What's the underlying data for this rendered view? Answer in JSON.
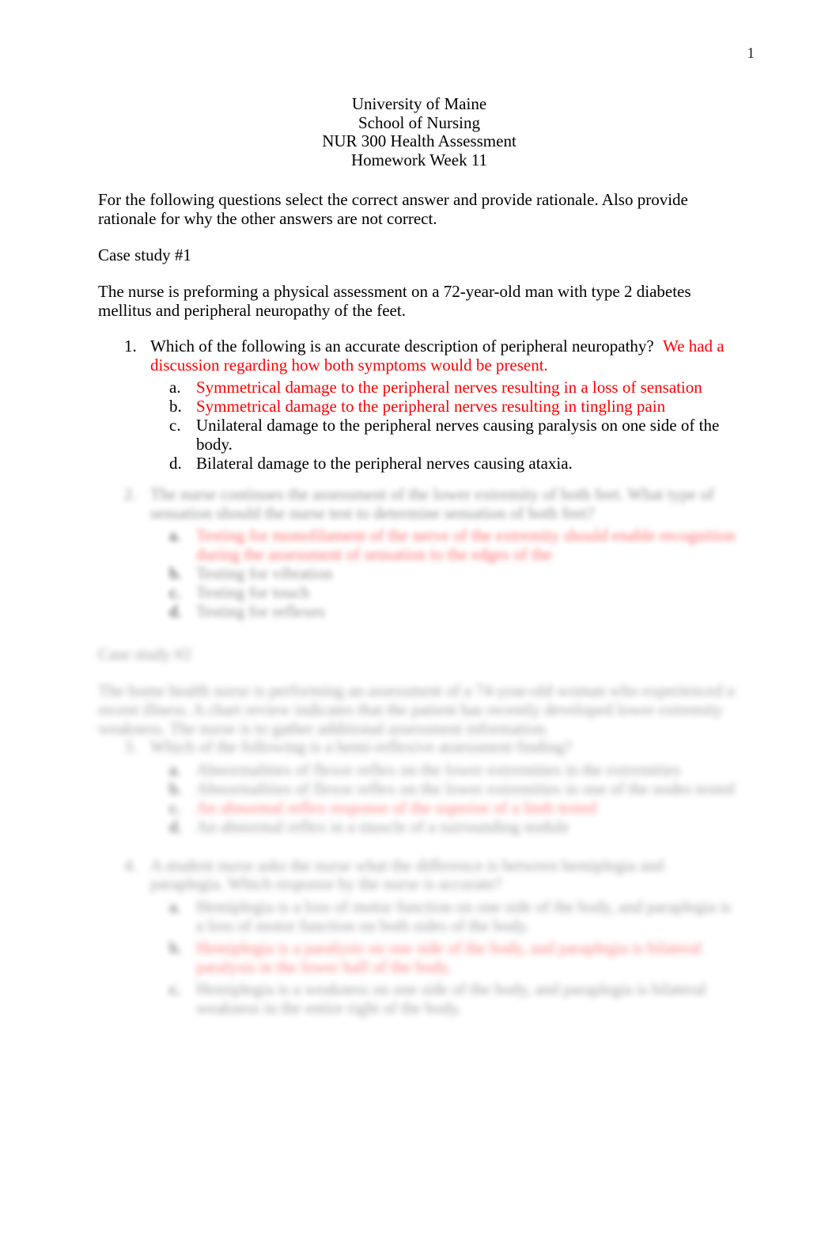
{
  "document": {
    "page_number": "1",
    "accent_red": "#ff0000",
    "text_color": "#000000",
    "background": "#ffffff"
  },
  "header": {
    "lines": [
      "University of Maine",
      "School of Nursing",
      "NUR 300 Health Assessment",
      "Homework Week 11"
    ]
  },
  "intro": {
    "instructions": "For the following questions select the correct answer and provide rationale.    Also provide rationale for why the other answers are not correct."
  },
  "case_study_1": {
    "label": "Case study #1",
    "description": "The nurse is preforming a physical assessment on a 72-year-old man with type 2 diabetes mellitus and peripheral neuropathy of the feet."
  },
  "question_1": {
    "number": "1.",
    "stem": "Which of the following is an accurate description of peripheral neuropathy?",
    "annotation": "We had a discussion regarding how both symptoms would be present.",
    "options": [
      {
        "letter": "a.",
        "text": "Symmetrical damage to the peripheral nerves resulting in a loss of sensation",
        "color": "red"
      },
      {
        "letter": "b.",
        "text": "Symmetrical damage to the peripheral nerves resulting in tingling pain",
        "color": "red"
      },
      {
        "letter": "c.",
        "text": "Unilateral damage to the peripheral nerves causing paralysis on one side of the body.",
        "color": "black"
      },
      {
        "letter": "d.",
        "text": "Bilateral damage to the peripheral nerves causing ataxia.",
        "color": "black"
      }
    ]
  },
  "question_2": {
    "number": "2.",
    "stem_obscured": "The nurse continues the assessment of the lower extremity of both feet.    What type of sensation should the nurse test to determine sensation of both feet?",
    "options": [
      {
        "letter": "a.",
        "text": "Testing for monofilament of the nerve of the extremity should enable recognition during the assessment of sensation to the edges of the",
        "color": "red"
      },
      {
        "letter": "b.",
        "text": "Testing for vibration",
        "color": "black"
      },
      {
        "letter": "c.",
        "text": "Testing for touch",
        "color": "black"
      },
      {
        "letter": "d.",
        "text": "Testing for reflexes",
        "color": "black"
      }
    ]
  },
  "case_study_2": {
    "label": "Case study #2",
    "description_obscured": "The home health nurse is performing an assessment of a 74-year-old woman who experienced a recent illness. A chart review indicates that the patient has recently developed lower extremity weakness. The nurse is to gather additional assessment information."
  },
  "question_3": {
    "number": "3.",
    "stem_obscured": "Which of the following is a hemi-reflexive assessment finding?",
    "options": [
      {
        "letter": "a.",
        "text": "Abnormalities of flexor reflex on the lower extremities in the extremities",
        "color": "black"
      },
      {
        "letter": "b.",
        "text": "Abnormalities of flexor reflex on the lower extremities in one of the nodes tested",
        "color": "black"
      },
      {
        "letter": "c.",
        "text": "An abnormal reflex response of the superior of a limb tested",
        "color": "red"
      },
      {
        "letter": "d.",
        "text": "An abnormal reflex in a muscle of a surrounding nodule",
        "color": "black"
      }
    ]
  },
  "question_4": {
    "number": "4.",
    "stem_obscured": "A student nurse asks the nurse what the difference is between hemiplegia and paraplegia. Which response by the nurse is accurate?",
    "options": [
      {
        "letter": "a.",
        "text": "Hemiplegia is a loss of motor function on one side of the body, and paraplegia is a loss of motor function on both sides of the body.",
        "color": "black"
      },
      {
        "letter": "b.",
        "text": "Hemiplegia is a paralysis on one side of the body, and paraplegia is bilateral paralysis in the lower half of the body.",
        "color": "red"
      },
      {
        "letter": "c.",
        "text": "Hemiplegia is a weakness on one side of the body, and paraplegia is bilateral weakness in the entire right of the body.",
        "color": "black"
      }
    ]
  }
}
